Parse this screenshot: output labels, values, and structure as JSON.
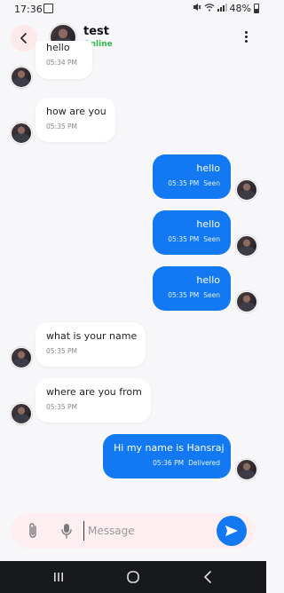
{
  "status_bar": {
    "time": "17:36",
    "battery": "48%"
  },
  "header": {
    "name": "test",
    "status": "Online"
  },
  "messages": [
    {
      "direction": "in",
      "text": "hello",
      "time": "05:34 PM"
    },
    {
      "direction": "in",
      "text": "how are you",
      "time": "05:35 PM"
    },
    {
      "direction": "out",
      "text": "hello",
      "time": "05:35 PM",
      "status": "Seen"
    },
    {
      "direction": "out",
      "text": "hello",
      "time": "05:35 PM",
      "status": "Seen"
    },
    {
      "direction": "out",
      "text": "hello",
      "time": "05:35 PM",
      "status": "Seen"
    },
    {
      "direction": "in",
      "text": "what is your name",
      "time": "05:35 PM"
    },
    {
      "direction": "in",
      "text": "where are you from",
      "time": "05:35 PM"
    },
    {
      "direction": "out",
      "text": "Hi my name is Hansraj",
      "time": "05:36 PM",
      "status": "Delivered"
    }
  ],
  "composer": {
    "placeholder": "Message",
    "value": ""
  },
  "colors": {
    "accent": "#1279f2",
    "online": "#2db84c",
    "back_button_bg": "#fde8ea",
    "composer_bg": "#fdeff1"
  },
  "icons": {
    "back": "chevron-left-icon",
    "menu": "kebab-menu-icon",
    "attach": "paperclip-icon",
    "mic": "microphone-icon",
    "send": "send-icon",
    "nav_recent": "recent-apps-icon",
    "nav_home": "home-icon",
    "nav_back": "back-icon"
  }
}
